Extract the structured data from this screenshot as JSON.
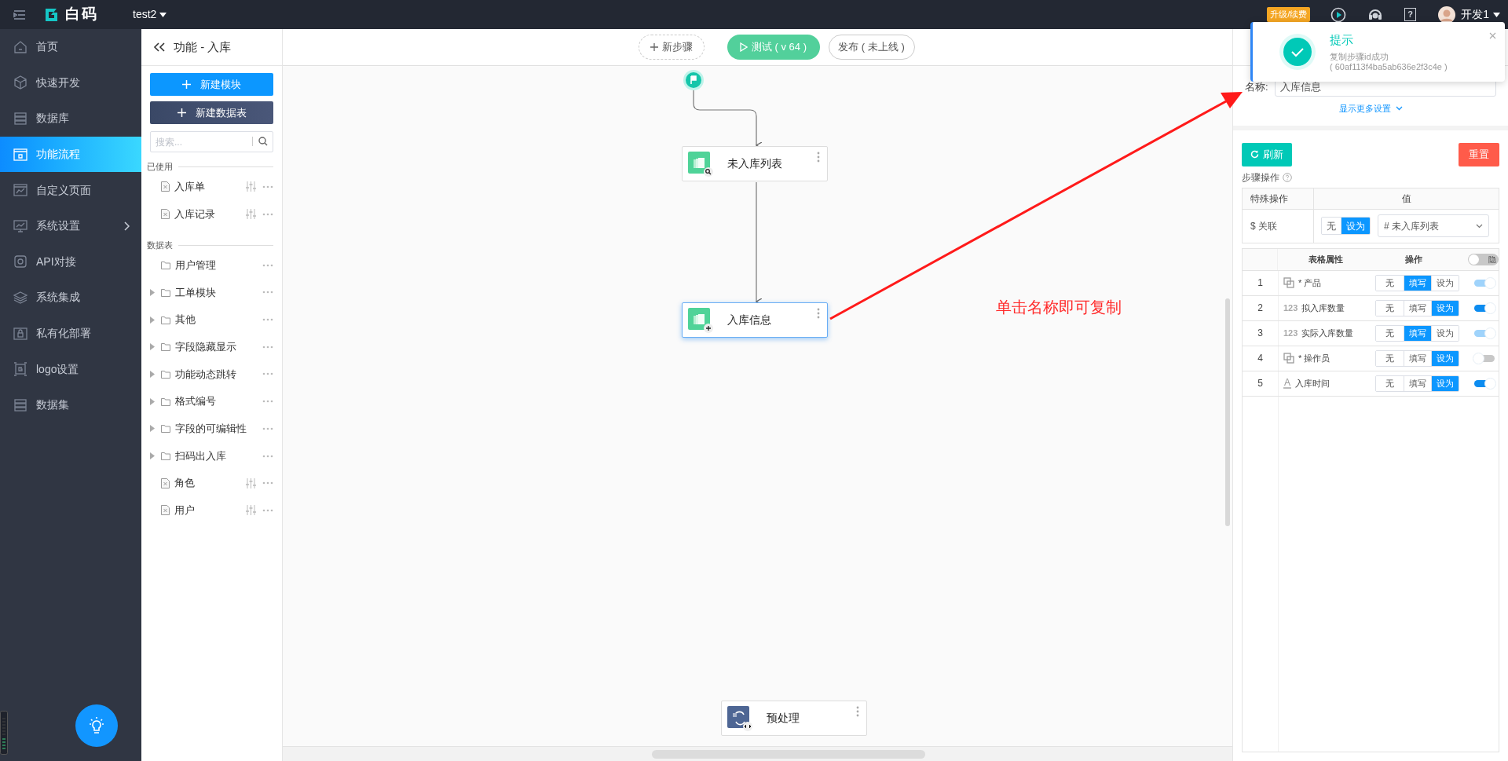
{
  "topbar": {
    "logo_text": "白码",
    "app_name": "test2",
    "upgrade_badge": "升级/续费",
    "help_glyph": "?",
    "user_name": "开发1"
  },
  "sidebar": {
    "items": [
      {
        "label": "首页",
        "selected": false,
        "has_submenu": false
      },
      {
        "label": "快速开发",
        "selected": false,
        "has_submenu": false
      },
      {
        "label": "数据库",
        "selected": false,
        "has_submenu": false
      },
      {
        "label": "功能流程",
        "selected": true,
        "has_submenu": false
      },
      {
        "label": "自定义页面",
        "selected": false,
        "has_submenu": false
      },
      {
        "label": "系统设置",
        "selected": false,
        "has_submenu": true
      },
      {
        "label": "API对接",
        "selected": false,
        "has_submenu": false
      },
      {
        "label": "系统集成",
        "selected": false,
        "has_submenu": false
      },
      {
        "label": "私有化部署",
        "selected": false,
        "has_submenu": false
      },
      {
        "label": "logo设置",
        "selected": false,
        "has_submenu": false
      },
      {
        "label": "数据集",
        "selected": false,
        "has_submenu": false
      }
    ]
  },
  "module_panel": {
    "title": "功能 - 入库",
    "buttons": [
      {
        "label": "新建模块",
        "kind": "primary"
      },
      {
        "label": "新建数据表",
        "kind": "dark"
      }
    ],
    "search": {
      "placeholder": "搜索..."
    },
    "sections": [
      {
        "title": "已使用",
        "items": [
          {
            "label": "入库单",
            "kind": "table",
            "has_children": false
          },
          {
            "label": "入库记录",
            "kind": "table",
            "has_children": false
          }
        ]
      },
      {
        "title": "数据表",
        "items": [
          {
            "label": "用户管理",
            "kind": "folder",
            "has_children": false
          },
          {
            "label": "工单模块",
            "kind": "folder",
            "has_children": true
          },
          {
            "label": "其他",
            "kind": "folder",
            "has_children": true
          },
          {
            "label": "字段隐藏显示",
            "kind": "folder",
            "has_children": true
          },
          {
            "label": "功能动态跳转",
            "kind": "folder",
            "has_children": true
          },
          {
            "label": "格式编号",
            "kind": "folder",
            "has_children": true
          },
          {
            "label": "字段的可编辑性",
            "kind": "folder",
            "has_children": true
          },
          {
            "label": "扫码出入库",
            "kind": "folder",
            "has_children": true
          },
          {
            "label": "角色",
            "kind": "table",
            "has_children": false
          },
          {
            "label": "用户",
            "kind": "table",
            "has_children": false
          }
        ]
      }
    ]
  },
  "canvas": {
    "toolbar": [
      {
        "label": "新步骤",
        "kind": "add"
      },
      {
        "label": "测试 ( v 64 )",
        "kind": "test"
      },
      {
        "label": "发布 ( 未上线 )",
        "kind": "publish"
      }
    ],
    "nodes": [
      {
        "label": "未入库列表",
        "kind": "query",
        "selected": false
      },
      {
        "label": "入库信息",
        "kind": "add",
        "selected": true
      },
      {
        "label": "预处理",
        "kind": "script",
        "selected": false
      }
    ],
    "annotation": "单击名称即可复制"
  },
  "notification": {
    "title": "提示",
    "message": "复制步骤id成功",
    "detail": "( 60af113f4ba5ab636e2f3c4e )"
  },
  "step_panel": {
    "name_label": "名称:",
    "name_value": "入库信息",
    "more_settings": "显示更多设置",
    "refresh_button": "刷新",
    "reset_button": "重置",
    "section_title": "步骤操作",
    "special_table": {
      "columns": [
        "特殊操作",
        "值"
      ],
      "rows": [
        {
          "name": "$ 关联",
          "options": [
            {
              "label": "无",
              "selected": false
            },
            {
              "label": "设为",
              "selected": true
            }
          ],
          "value": "# 未入库列表"
        }
      ]
    },
    "fields_table": {
      "columns": [
        "表格属性",
        "操作"
      ],
      "hide_toggle": {
        "label": "隐",
        "on": false
      },
      "rows": [
        {
          "index": "1",
          "kind": "relation",
          "label": "* 产品",
          "options": [
            {
              "label": "无",
              "selected": false
            },
            {
              "label": "填写",
              "selected": true
            },
            {
              "label": "设为",
              "selected": false
            }
          ],
          "on": true,
          "disabled": true
        },
        {
          "index": "2",
          "kind": "number",
          "glyph": "123",
          "label": "拟入库数量",
          "options": [
            {
              "label": "无",
              "selected": false
            },
            {
              "label": "填写",
              "selected": false
            },
            {
              "label": "设为",
              "selected": true
            }
          ],
          "on": true,
          "disabled": false
        },
        {
          "index": "3",
          "kind": "number",
          "glyph": "123",
          "label": "实际入库数量",
          "options": [
            {
              "label": "无",
              "selected": false
            },
            {
              "label": "填写",
              "selected": true
            },
            {
              "label": "设为",
              "selected": false
            }
          ],
          "on": true,
          "disabled": true
        },
        {
          "index": "4",
          "kind": "relation",
          "label": "* 操作员",
          "options": [
            {
              "label": "无",
              "selected": false
            },
            {
              "label": "填写",
              "selected": false
            },
            {
              "label": "设为",
              "selected": true
            }
          ],
          "on": false,
          "disabled": false
        },
        {
          "index": "5",
          "kind": "text",
          "glyph": "A",
          "label": "入库时间",
          "options": [
            {
              "label": "无",
              "selected": false
            },
            {
              "label": "填写",
              "selected": false
            },
            {
              "label": "设为",
              "selected": true
            }
          ],
          "on": true,
          "disabled": false
        }
      ]
    }
  }
}
